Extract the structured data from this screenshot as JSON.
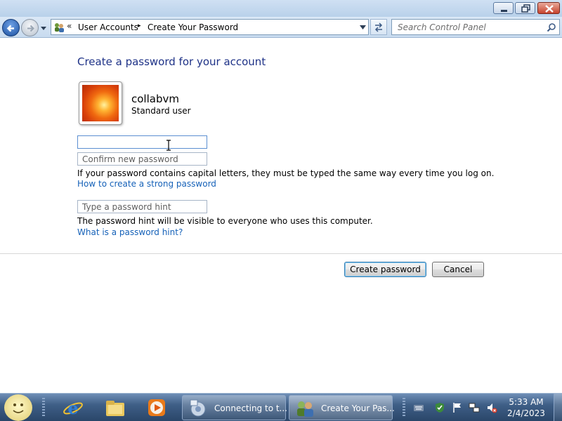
{
  "window": {
    "controls": {
      "minimize_icon": "minimize-icon",
      "maximize_icon": "restore-icon",
      "close_icon": "close-icon"
    }
  },
  "navbar": {
    "breadcrumb_prefix": "«",
    "breadcrumbs": [
      "User Accounts",
      "Create Your Password"
    ],
    "breadcrumb_separator": "▸",
    "search_placeholder": "Search Control Panel"
  },
  "page": {
    "title": "Create a password for your account",
    "user": {
      "name": "collabvm",
      "type": "Standard user"
    },
    "fields": {
      "new_password": {
        "value": "",
        "placeholder": ""
      },
      "confirm_password": {
        "value": "",
        "placeholder": "Confirm new password"
      },
      "password_hint": {
        "value": "",
        "placeholder": "Type a password hint"
      }
    },
    "caps_note": "If your password contains capital letters, they must be typed the same way every time you log on.",
    "strong_link": "How to create a strong password",
    "hint_note": "The password hint will be visible to everyone who uses this computer.",
    "hint_link": "What is a password hint?",
    "buttons": {
      "create": "Create password",
      "cancel": "Cancel"
    }
  },
  "taskbar": {
    "tasks": [
      {
        "label": "Connecting to t...",
        "icon": "wizard-icon"
      },
      {
        "label": "Create Your Pas...",
        "icon": "user-accounts-icon"
      }
    ],
    "clock": {
      "time": "5:33 AM",
      "date": "2/4/2023"
    }
  },
  "colors": {
    "title_blue": "#1e3287",
    "link_blue": "#1561b8",
    "taskbar": "#3f5f87"
  }
}
